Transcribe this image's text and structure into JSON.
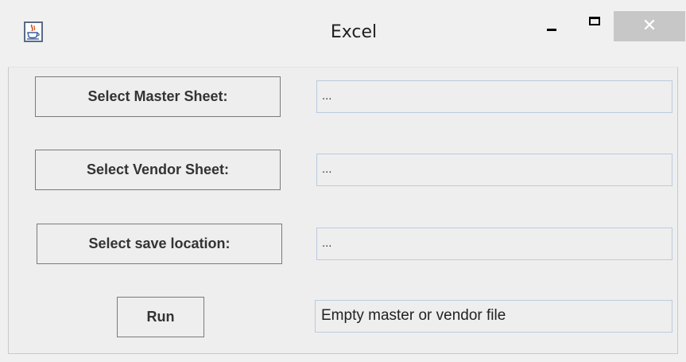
{
  "window": {
    "title": "Excel",
    "controls": {
      "minimize_icon": "minimize-icon",
      "maximize_icon": "maximize-icon",
      "close_icon": "close-icon",
      "close_glyph": "✕"
    },
    "app_icon": "java-coffee-cup-icon"
  },
  "form": {
    "master": {
      "button_label": "Select Master Sheet:",
      "path_value": "..."
    },
    "vendor": {
      "button_label": "Select Vendor Sheet:",
      "path_value": "..."
    },
    "save": {
      "button_label": "Select save location:",
      "path_value": "..."
    },
    "run": {
      "button_label": "Run",
      "status_text": "Empty master or vendor file"
    }
  },
  "colors": {
    "window_bg": "#f0f0f0",
    "close_button_bg": "#c7c7c7",
    "field_border": "#b9cbe0",
    "button_border": "#7a7a7a"
  }
}
